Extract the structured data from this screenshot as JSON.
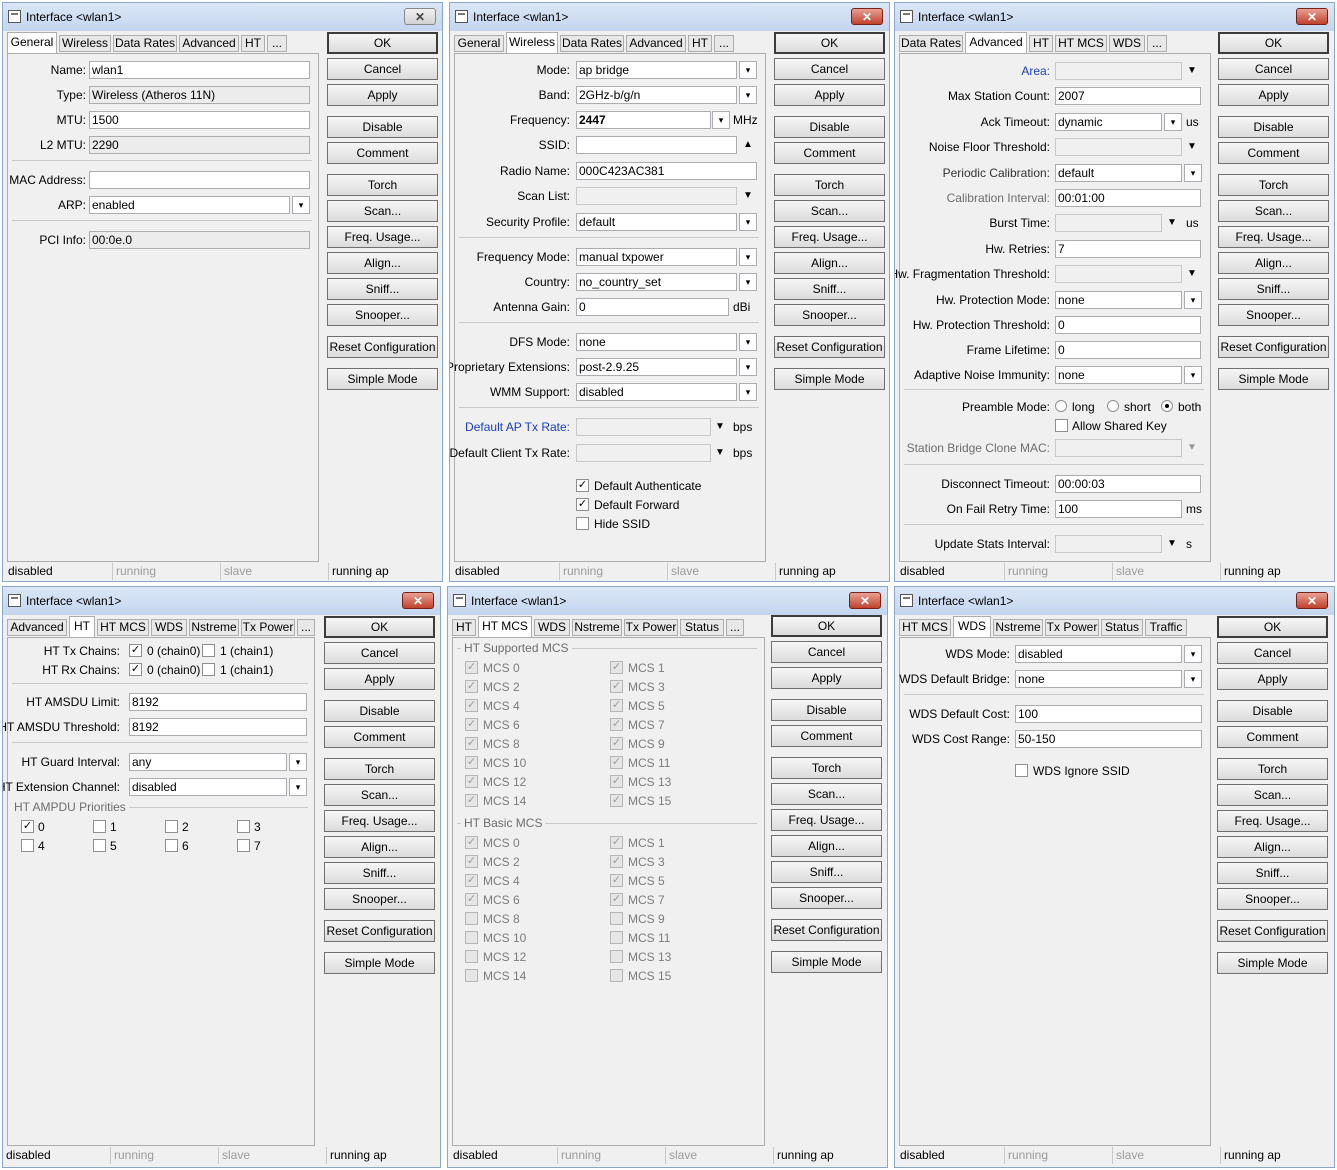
{
  "window_title": "Interface <wlan1>",
  "buttons": [
    "OK",
    "Cancel",
    "Apply",
    "Disable",
    "Comment",
    "Torch",
    "Scan...",
    "Freq. Usage...",
    "Align...",
    "Sniff...",
    "Snooper...",
    "Reset Configuration",
    "Simple Mode"
  ],
  "status": [
    "disabled",
    "running",
    "slave",
    "running ap"
  ],
  "w1": {
    "tabs": [
      "General",
      "Wireless",
      "Data Rates",
      "Advanced",
      "HT",
      "..."
    ],
    "name_label": "Name:",
    "name": "wlan1",
    "type_label": "Type:",
    "type": "Wireless (Atheros 11N)",
    "mtu_label": "MTU:",
    "mtu": "1500",
    "l2mtu_label": "L2 MTU:",
    "l2mtu": "2290",
    "mac_label": "MAC Address:",
    "mac": "",
    "arp_label": "ARP:",
    "arp": "enabled",
    "pci_label": "PCI Info:",
    "pci": "00:0e.0"
  },
  "w2": {
    "tabs": [
      "General",
      "Wireless",
      "Data Rates",
      "Advanced",
      "HT",
      "..."
    ],
    "mode_label": "Mode:",
    "mode": "ap bridge",
    "band_label": "Band:",
    "band": "2GHz-b/g/n",
    "freq_label": "Frequency:",
    "freq": "2447",
    "freq_unit": "MHz",
    "ssid_label": "SSID:",
    "ssid": "",
    "radio_label": "Radio Name:",
    "radio": "000C423AC381",
    "scan_label": "Scan List:",
    "scan": "",
    "sec_label": "Security Profile:",
    "sec": "default",
    "fmode_label": "Frequency Mode:",
    "fmode": "manual txpower",
    "country_label": "Country:",
    "country": "no_country_set",
    "ant_label": "Antenna Gain:",
    "ant": "0",
    "ant_unit": "dBi",
    "dfs_label": "DFS Mode:",
    "dfs": "none",
    "prop_label": "Proprietary Extensions:",
    "prop": "post-2.9.25",
    "wmm_label": "WMM Support:",
    "wmm": "disabled",
    "daptx_label": "Default AP Tx Rate:",
    "dcltx_label": "Default Client Tx Rate:",
    "bps": "bps",
    "cb_auth": "Default Authenticate",
    "cb_fwd": "Default Forward",
    "cb_hide": "Hide SSID"
  },
  "w3": {
    "tabs": [
      "Data Rates",
      "Advanced",
      "HT",
      "HT MCS",
      "WDS",
      "..."
    ],
    "area_label": "Area:",
    "msc_label": "Max Station Count:",
    "msc": "2007",
    "ack_label": "Ack Timeout:",
    "ack": "dynamic",
    "us": "us",
    "noise_label": "Noise Floor Threshold:",
    "pcal_label": "Periodic Calibration:",
    "pcal": "default",
    "cint_label": "Calibration Interval:",
    "cint": "00:01:00",
    "burst_label": "Burst Time:",
    "hwr_label": "Hw. Retries:",
    "hwr": "7",
    "hwf_label": "Hw. Fragmentation Threshold:",
    "hwp_label": "Hw. Protection Mode:",
    "hwp": "none",
    "hwpt_label": "Hw. Protection Threshold:",
    "hwpt": "0",
    "fl_label": "Frame Lifetime:",
    "fl": "0",
    "ani_label": "Adaptive Noise Immunity:",
    "ani": "none",
    "pre_label": "Preamble Mode:",
    "pre_long": "long",
    "pre_short": "short",
    "pre_both": "both",
    "shared_label": "Allow Shared Key",
    "sbc_label": "Station Bridge Clone MAC:",
    "dt_label": "Disconnect Timeout:",
    "dt": "00:00:03",
    "ofr_label": "On Fail Retry Time:",
    "ofr": "100",
    "ms": "ms",
    "usi_label": "Update Stats Interval:",
    "s": "s"
  },
  "w4": {
    "tabs": [
      "Advanced",
      "HT",
      "HT MCS",
      "WDS",
      "Nstreme",
      "Tx Power",
      "..."
    ],
    "tx_label": "HT Tx Chains:",
    "rx_label": "HT Rx Chains:",
    "chain0": "0 (chain0)",
    "chain1": "1 (chain1)",
    "amsdu_label": "HT AMSDU Limit:",
    "amsdu": "8192",
    "amsdut_label": "HT AMSDU Threshold:",
    "amsdut": "8192",
    "guard_label": "HT Guard Interval:",
    "guard": "any",
    "ext_label": "HT Extension Channel:",
    "ext": "disabled",
    "ampdu_label": "HT AMPDU Priorities",
    "prio": [
      "0",
      "1",
      "2",
      "3",
      "4",
      "5",
      "6",
      "7"
    ]
  },
  "w5": {
    "tabs": [
      "HT",
      "HT MCS",
      "WDS",
      "Nstreme",
      "Tx Power",
      "Status",
      "..."
    ],
    "sup_label": "HT Supported MCS",
    "basic_label": "HT Basic MCS",
    "mcs": [
      "MCS 0",
      "MCS 1",
      "MCS 2",
      "MCS 3",
      "MCS 4",
      "MCS 5",
      "MCS 6",
      "MCS 7",
      "MCS 8",
      "MCS 9",
      "MCS 10",
      "MCS 11",
      "MCS 12",
      "MCS 13",
      "MCS 14",
      "MCS 15"
    ]
  },
  "w6": {
    "tabs": [
      "HT MCS",
      "WDS",
      "Nstreme",
      "Tx Power",
      "Status",
      "Traffic"
    ],
    "wm_label": "WDS Mode:",
    "wm": "disabled",
    "wb_label": "WDS Default Bridge:",
    "wb": "none",
    "wc_label": "WDS Default Cost:",
    "wc": "100",
    "wr_label": "WDS Cost Range:",
    "wr": "50-150",
    "wi_label": "WDS Ignore SSID"
  },
  "glyphs": {
    "check": "✓",
    "down_arrow": "▼",
    "up_arrow": "▲",
    "dd": "▾",
    "close": "✕"
  }
}
